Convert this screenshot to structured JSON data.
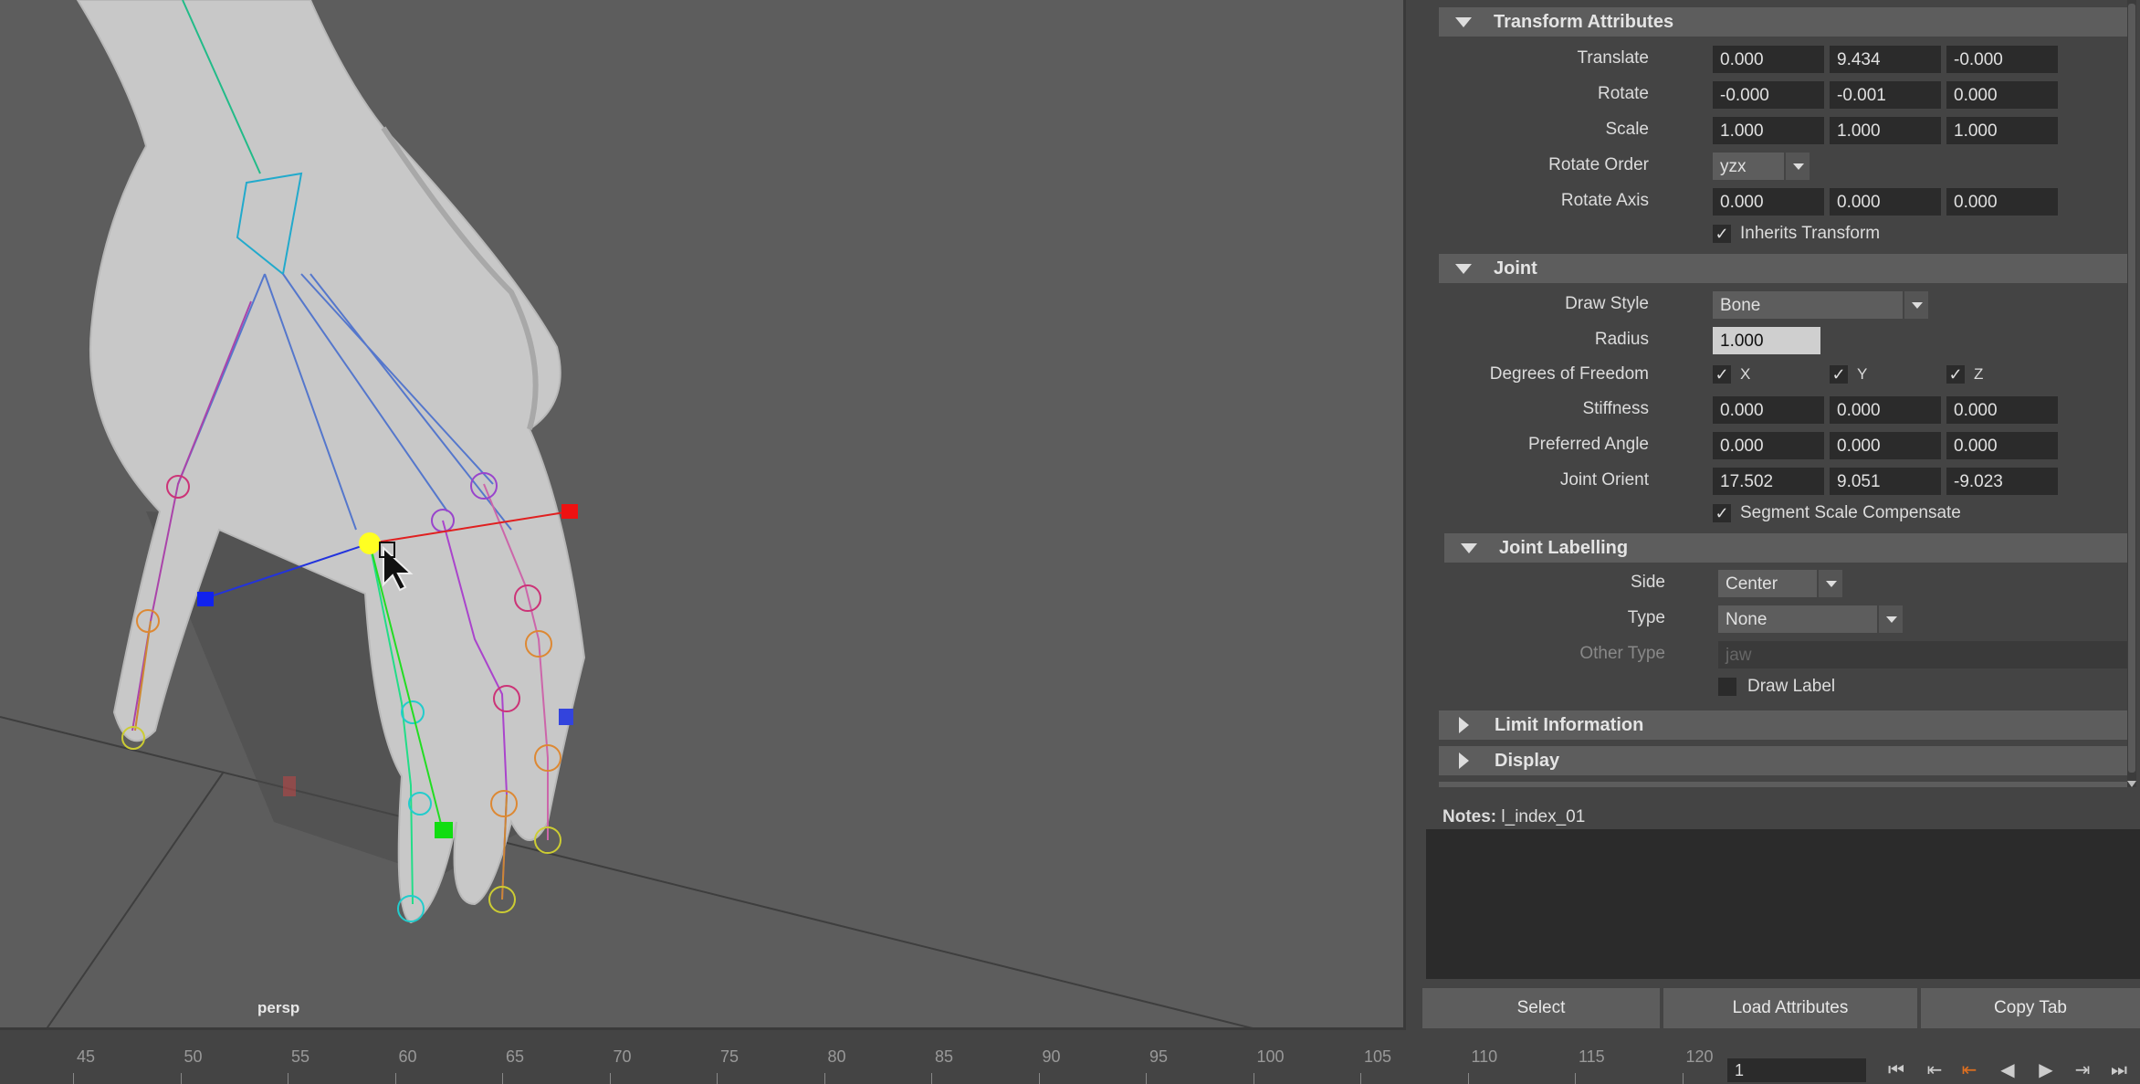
{
  "viewport": {
    "camera": "persp"
  },
  "sections": {
    "transform": "Transform Attributes",
    "joint": "Joint",
    "joint_labelling": "Joint Labelling",
    "limit_information": "Limit Information",
    "display": "Display"
  },
  "transform": {
    "translate": {
      "label": "Translate",
      "x": "0.000",
      "y": "9.434",
      "z": "-0.000"
    },
    "rotate": {
      "label": "Rotate",
      "x": "-0.000",
      "y": "-0.001",
      "z": "0.000"
    },
    "scale": {
      "label": "Scale",
      "x": "1.000",
      "y": "1.000",
      "z": "1.000"
    },
    "rotate_order": {
      "label": "Rotate Order",
      "value": "yzx"
    },
    "rotate_axis": {
      "label": "Rotate Axis",
      "x": "0.000",
      "y": "0.000",
      "z": "0.000"
    },
    "inherits_transform": {
      "label": "Inherits Transform",
      "checked": true
    }
  },
  "joint": {
    "draw_style": {
      "label": "Draw Style",
      "value": "Bone"
    },
    "radius": {
      "label": "Radius",
      "value": "1.000"
    },
    "dof": {
      "label": "Degrees of Freedom",
      "x": "X",
      "y": "Y",
      "z": "Z"
    },
    "stiffness": {
      "label": "Stiffness",
      "x": "0.000",
      "y": "0.000",
      "z": "0.000"
    },
    "preferred_angle": {
      "label": "Preferred Angle",
      "x": "0.000",
      "y": "0.000",
      "z": "0.000"
    },
    "joint_orient": {
      "label": "Joint Orient",
      "x": "17.502",
      "y": "9.051",
      "z": "-9.023"
    },
    "segment_scale": {
      "label": "Segment Scale Compensate",
      "checked": true
    }
  },
  "joint_labelling": {
    "side": {
      "label": "Side",
      "value": "Center"
    },
    "type": {
      "label": "Type",
      "value": "None"
    },
    "other_type": {
      "label": "Other Type",
      "value": "jaw"
    },
    "draw_label": {
      "label": "Draw Label",
      "checked": false
    }
  },
  "notes": {
    "label": "Notes:",
    "value": "l_index_01"
  },
  "buttons": {
    "select": "Select",
    "load_attributes": "Load Attributes",
    "copy_tab": "Copy Tab"
  },
  "timeline": {
    "ticks": [
      "45",
      "50",
      "55",
      "60",
      "65",
      "70",
      "75",
      "80",
      "85",
      "90",
      "95",
      "100",
      "105",
      "110",
      "115",
      "120"
    ],
    "current_frame": "1"
  },
  "colors": {
    "annotation": "#e01010",
    "selected_joint": "#ffff00"
  }
}
